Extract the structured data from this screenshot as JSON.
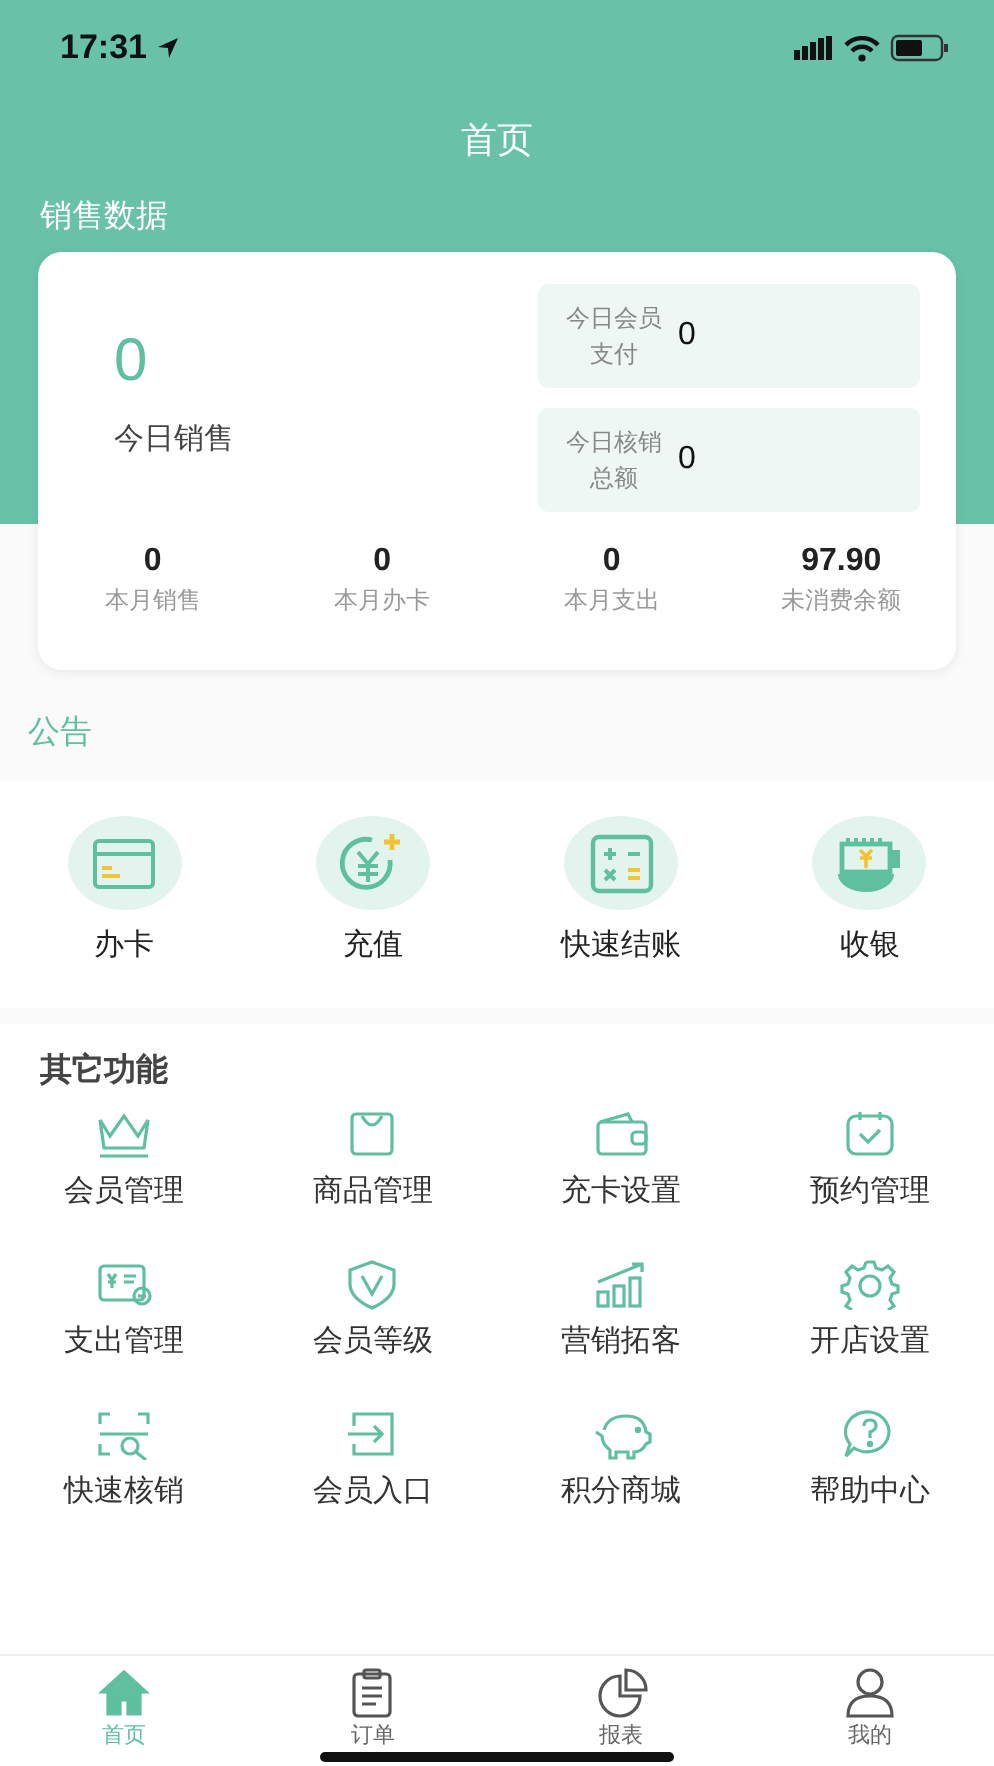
{
  "status_bar": {
    "time": "17:31"
  },
  "header": {
    "title": "首页",
    "section_title": "销售数据"
  },
  "sales_card": {
    "today_value": "0",
    "today_label": "今日销售",
    "side_stats": [
      {
        "label": "今日会员支付",
        "value": "0"
      },
      {
        "label": "今日核销总额",
        "value": "0"
      }
    ],
    "month_stats": [
      {
        "value": "0",
        "label": "本月销售"
      },
      {
        "value": "0",
        "label": "本月办卡"
      },
      {
        "value": "0",
        "label": "本月支出"
      },
      {
        "value": "97.90",
        "label": "未消费余额"
      }
    ]
  },
  "notice": {
    "title": "公告"
  },
  "quick_actions": [
    {
      "label": "办卡"
    },
    {
      "label": "充值"
    },
    {
      "label": "快速结账"
    },
    {
      "label": "收银"
    }
  ],
  "other_functions": {
    "title": "其它功能",
    "items": [
      {
        "label": "会员管理"
      },
      {
        "label": "商品管理"
      },
      {
        "label": "充卡设置"
      },
      {
        "label": "预约管理"
      },
      {
        "label": "支出管理"
      },
      {
        "label": "会员等级"
      },
      {
        "label": "营销拓客"
      },
      {
        "label": "开店设置"
      },
      {
        "label": "快速核销"
      },
      {
        "label": "会员入口"
      },
      {
        "label": "积分商城"
      },
      {
        "label": "帮助中心"
      }
    ]
  },
  "tab_bar": [
    {
      "label": "首页",
      "selected": true
    },
    {
      "label": "订单",
      "selected": false
    },
    {
      "label": "报表",
      "selected": false
    },
    {
      "label": "我的",
      "selected": false
    }
  ]
}
